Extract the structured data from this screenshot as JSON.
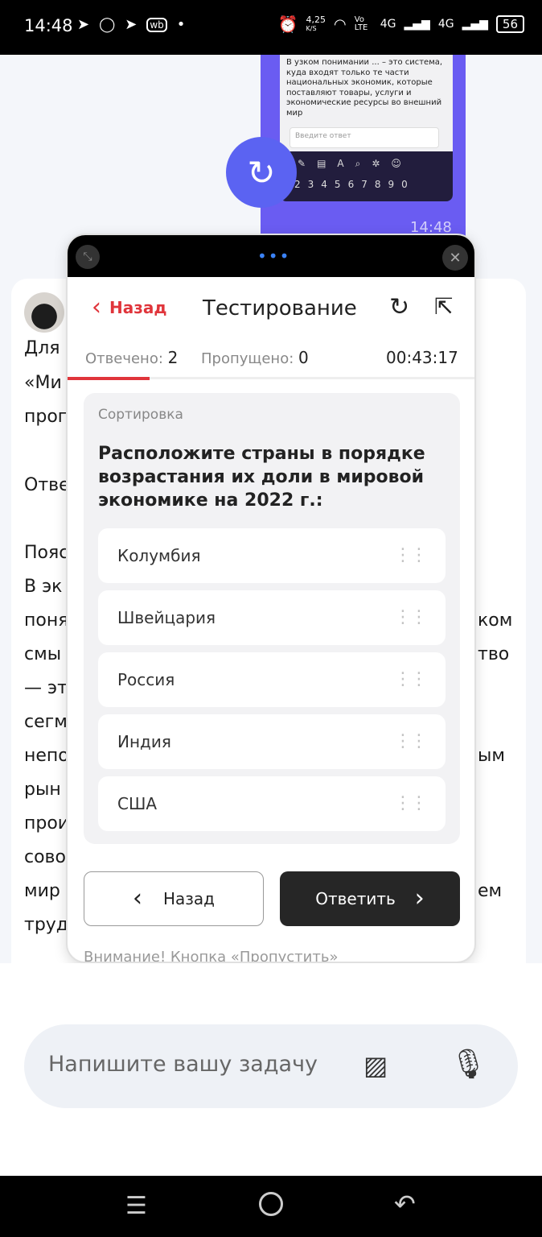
{
  "status_bar": {
    "time": "14:48",
    "net_speed": "4,25",
    "net_unit": "K/S",
    "volte": "Vo LTE",
    "signal1": "4G",
    "signal2": "4G",
    "battery": "56"
  },
  "chat": {
    "image_preview": {
      "question_text": "В узком понимании ... – это система, куда входят только те части национальных экономик, которые поставляют товары, услуги и экономические ресурсы во внешний мир",
      "input_placeholder": "Введите ответ",
      "keyboard_numbers": [
        "2",
        "3",
        "4",
        "5",
        "6",
        "7",
        "8",
        "9",
        "0"
      ],
      "time": "14:48"
    },
    "answer_fragments": {
      "line1": "Для",
      "line2": "«Ми",
      "line3": "прог",
      "line4": "Отве",
      "line5": "Пояс",
      "line6": "В эк",
      "line7": "поня",
      "line8": "смы",
      "line9": "— эт",
      "line10": "сегм",
      "line11": "непо",
      "line12": "рын",
      "line13": "прои",
      "line14": "сово",
      "line15": "мир",
      "line16": "труд",
      "r1": "ком",
      "r2": "тво",
      "r3": "ым",
      "r4": "ем"
    }
  },
  "popup": {
    "back_label": "Назад",
    "title": "Тестирование",
    "answered_label": "Отвечено:",
    "answered_value": "2",
    "skipped_label": "Пропущено:",
    "skipped_value": "0",
    "timer": "00:43:17",
    "progress_fraction": 0.2,
    "question_type": "Сортировка",
    "question": "Расположите страны в порядке возрастания их доли в мировой экономике на 2022 г.:",
    "items": [
      "Колумбия",
      "Швейцария",
      "Россия",
      "Индия",
      "США"
    ],
    "btn_back": "Назад",
    "btn_answer": "Ответить",
    "warning": "Внимание! Кнопка «Пропустить»"
  },
  "input": {
    "placeholder": "Напишите вашу задачу"
  },
  "colors": {
    "accent_red": "#e0353b",
    "fab_purple": "#5b63f2",
    "answer_button": "#262626"
  },
  "icons": {
    "telegram": "telegram-icon",
    "wb": "wb"
  }
}
